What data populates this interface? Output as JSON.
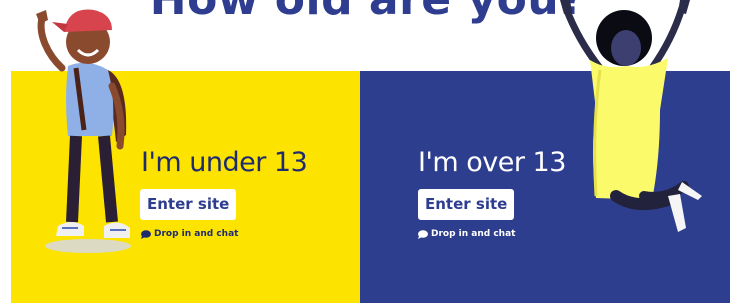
{
  "heading": "How old are you?",
  "under": {
    "title": "I'm under 13",
    "button": "Enter site",
    "chat": "Drop in and chat"
  },
  "over": {
    "title": "I'm over 13",
    "button": "Enter site",
    "chat": "Drop in and chat"
  },
  "colors": {
    "yellow": "#fde400",
    "navy": "#2e3e8f"
  },
  "icons": [
    "speech-bubble-icon"
  ]
}
